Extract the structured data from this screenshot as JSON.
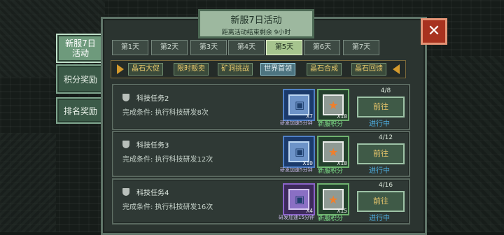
{
  "header": {
    "title": "新服7日活动",
    "subtitle": "距离活动结束剩余  9小时"
  },
  "close_icon": "close-x-icon",
  "side_tabs": [
    {
      "label": "新服7日活动",
      "active": true
    },
    {
      "label": "积分奖励",
      "active": false
    },
    {
      "label": "排名奖励",
      "active": false
    }
  ],
  "day_tabs": [
    {
      "label": "第1天",
      "active": false
    },
    {
      "label": "第2天",
      "active": false
    },
    {
      "label": "第3天",
      "active": false
    },
    {
      "label": "第4天",
      "active": false
    },
    {
      "label": "第5天",
      "active": true
    },
    {
      "label": "第6天",
      "active": false
    },
    {
      "label": "第7天",
      "active": false
    }
  ],
  "categories": [
    {
      "label": "晶石大促",
      "active": false
    },
    {
      "label": "限时贩卖",
      "active": false
    },
    {
      "label": "矿洞挑战",
      "active": false
    },
    {
      "label": "世界首领",
      "active": true
    },
    {
      "label": "晶石合成",
      "active": false
    },
    {
      "label": "晶石回馈",
      "active": false
    }
  ],
  "tasks": [
    {
      "name": "科技任务2",
      "condition": "完成条件: 执行科技研发8次",
      "reward1": {
        "qty": "X7",
        "label": "研发加速5分钟",
        "icon": "chip-icon",
        "color": "blue"
      },
      "reward2": {
        "qty": "X10",
        "label": "新服积分",
        "icon": "points-star-icon"
      },
      "progress": "4/8",
      "button": "前往",
      "status": "进行中"
    },
    {
      "name": "科技任务3",
      "condition": "完成条件: 执行科技研发12次",
      "reward1": {
        "qty": "X10",
        "label": "研发加速5分钟",
        "icon": "chip-icon",
        "color": "blue"
      },
      "reward2": {
        "qty": "X10",
        "label": "新服积分",
        "icon": "points-star-icon"
      },
      "progress": "4/12",
      "button": "前往",
      "status": "进行中"
    },
    {
      "name": "科技任务4",
      "condition": "完成条件: 执行科技研发16次",
      "reward1": {
        "qty": "X4",
        "label": "研发加速15分钟",
        "icon": "chip-icon",
        "color": "purple"
      },
      "reward2": {
        "qty": "X15",
        "label": "新服积分",
        "icon": "points-star-icon"
      },
      "progress": "4/16",
      "button": "前往",
      "status": "进行中"
    }
  ]
}
